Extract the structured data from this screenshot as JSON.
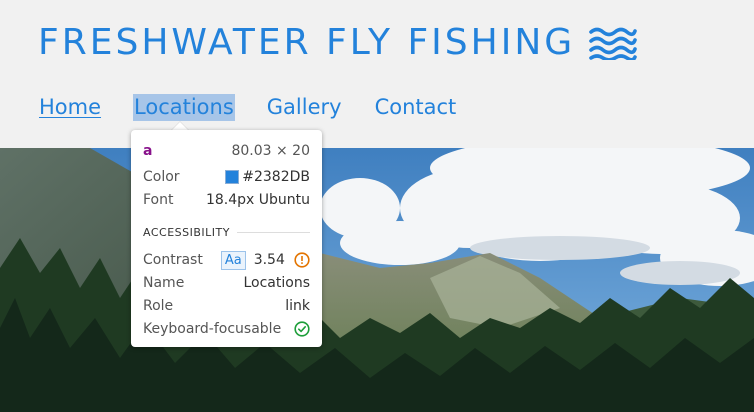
{
  "site": {
    "title": "FRESHWATER FLY FISHING",
    "title_icon": "waves-icon",
    "brand_color": "#2382DB"
  },
  "nav": {
    "items": [
      {
        "label": "Home",
        "state": "active"
      },
      {
        "label": "Locations",
        "state": "hovered"
      },
      {
        "label": "Gallery",
        "state": "normal"
      },
      {
        "label": "Contact",
        "state": "normal"
      }
    ]
  },
  "inspector": {
    "tag": "a",
    "dimensions": "80.03 × 20",
    "color_label": "Color",
    "color_value": "#2382DB",
    "font_label": "Font",
    "font_value": "18.4px Ubuntu",
    "section_title": "ACCESSIBILITY",
    "contrast_label": "Contrast",
    "contrast_badge": "Aa",
    "contrast_value": "3.54",
    "contrast_status_icon": "warning-icon",
    "name_label": "Name",
    "name_value": "Locations",
    "role_label": "Role",
    "role_value": "link",
    "focusable_label": "Keyboard-focusable",
    "focusable_status_icon": "check-icon"
  }
}
